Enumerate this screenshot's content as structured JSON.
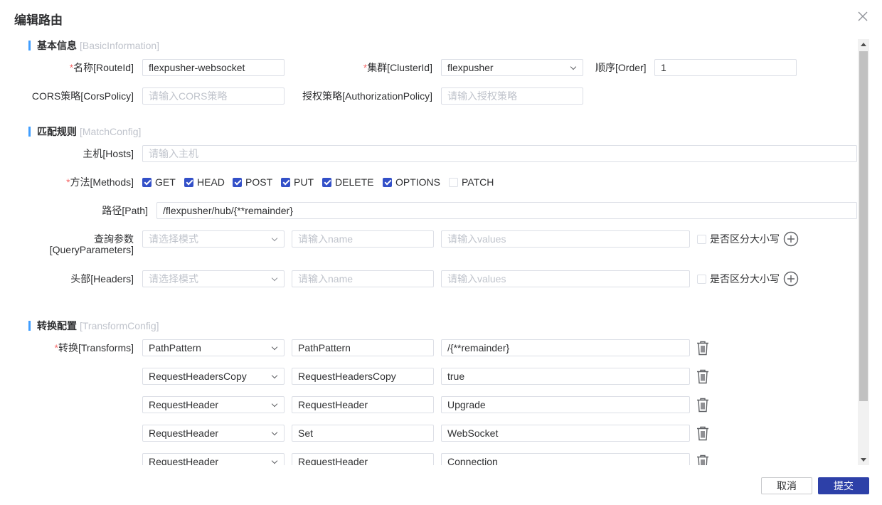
{
  "dialog": {
    "title": "编辑路由"
  },
  "basic": {
    "title": "基本信息",
    "subtitle": "[BasicInformation]",
    "name_label": "名称[RouteId]",
    "name_value": "flexpusher-websocket",
    "cluster_label": "集群[ClusterId]",
    "cluster_value": "flexpusher",
    "order_label": "顺序[Order]",
    "order_value": "1",
    "cors_label": "CORS策略[CorsPolicy]",
    "cors_placeholder": "请输入CORS策略",
    "auth_label": "授权策略[AuthorizationPolicy]",
    "auth_placeholder": "请输入授权策略",
    "required_mark": "*"
  },
  "match": {
    "title": "匹配规则",
    "subtitle": "[MatchConfig]",
    "hosts_label": "主机[Hosts]",
    "hosts_placeholder": "请输入主机",
    "methods_label": "方法[Methods]",
    "methods": [
      {
        "label": "GET",
        "checked": true
      },
      {
        "label": "HEAD",
        "checked": true
      },
      {
        "label": "POST",
        "checked": true
      },
      {
        "label": "PUT",
        "checked": true
      },
      {
        "label": "DELETE",
        "checked": true
      },
      {
        "label": "OPTIONS",
        "checked": true
      },
      {
        "label": "PATCH",
        "checked": false
      }
    ],
    "path_label": "路径[Path]",
    "path_value": "/flexpusher/hub/{**remainder}",
    "query_label_1": "查詢参数",
    "query_label_2": "[QueryParameters]",
    "headers_label": "头部[Headers]",
    "mode_placeholder": "请选择模式",
    "name_placeholder": "请输入name",
    "values_placeholder": "请输入values",
    "case_label": "是否区分大小写"
  },
  "transform": {
    "title": "转换配置",
    "subtitle": "[TransformConfig]",
    "label": "转换[Transforms]",
    "rows": [
      {
        "type": "PathPattern",
        "key": "PathPattern",
        "value": "/{**remainder}"
      },
      {
        "type": "RequestHeadersCopy",
        "key": "RequestHeadersCopy",
        "value": "true"
      },
      {
        "type": "RequestHeader",
        "key": "RequestHeader",
        "value": "Upgrade"
      },
      {
        "type": "RequestHeader",
        "key": "Set",
        "value": "WebSocket"
      },
      {
        "type": "RequestHeader",
        "key": "RequestHeader",
        "value": "Connection"
      }
    ]
  },
  "footer": {
    "cancel": "取消",
    "submit": "提交"
  },
  "colors": {
    "primary": "#2d40a8",
    "accent": "#409eff",
    "required": "#f56c6c"
  }
}
